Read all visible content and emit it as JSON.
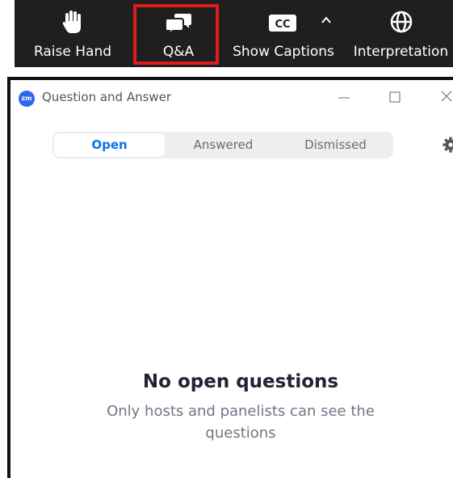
{
  "toolbar": {
    "items": [
      {
        "label": "Raise Hand",
        "icon": "raise-hand-icon"
      },
      {
        "label": "Q&A",
        "icon": "qa-chat-bubbles-icon"
      },
      {
        "label": "Show Captions",
        "icon": "cc-icon"
      },
      {
        "label": "Interpretation",
        "icon": "globe-icon"
      }
    ],
    "cc_badge": "CC",
    "background": "#1f1f1f",
    "highlight_color": "#e01b1b"
  },
  "window": {
    "app_icon_text": "zm",
    "title": "Question and Answer",
    "tabs": [
      {
        "label": "Open",
        "selected": true
      },
      {
        "label": "Answered",
        "selected": false
      },
      {
        "label": "Dismissed",
        "selected": false
      }
    ],
    "accent_color": "#0e71eb",
    "empty_state": {
      "title": "No open questions",
      "subtitle": "Only hosts and panelists can see the questions"
    }
  }
}
